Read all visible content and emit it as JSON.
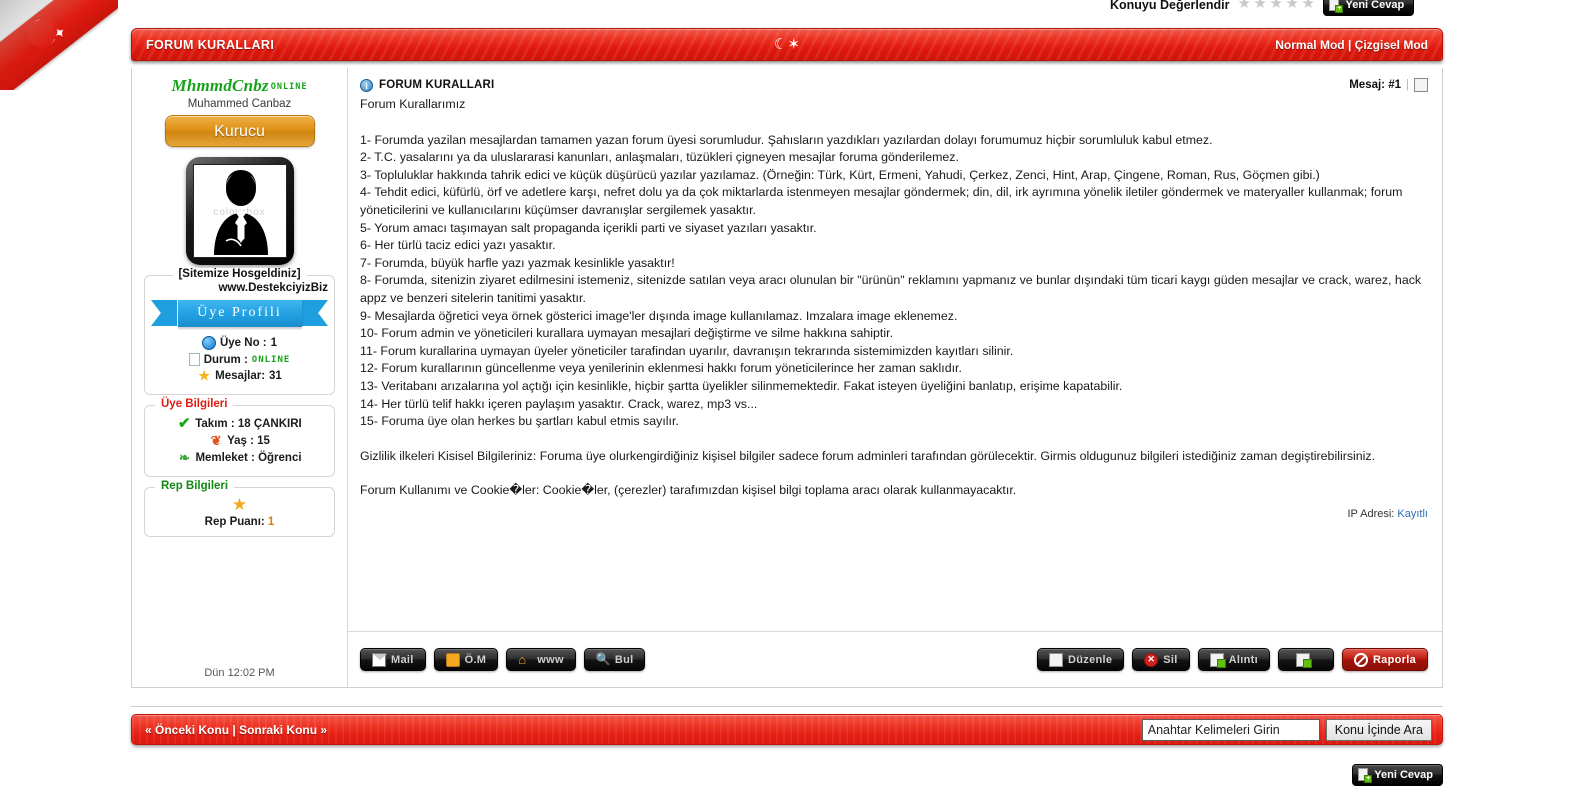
{
  "topbar": {
    "rating_label": "Konuyu Değerlendir",
    "stars": 5,
    "new_reply_label": "Yeni Cevap"
  },
  "titlebar": {
    "title": "FORUM KURALLARI",
    "center_icon": "turkish-crescent-star",
    "mode_normal": "Normal Mod",
    "mode_separator": "|",
    "mode_linear": "Çizgisel Mod"
  },
  "sidebar": {
    "username": "MhmmdCnbz",
    "online_tag": "ONLINE",
    "realname": "Muhammed Canbaz",
    "rank": "Kurucu",
    "avatar_watermark": "colourbox",
    "welcome_legend": "[Sitemize Hosgeldiniz]",
    "site_url": "www.DestekciyizBiz",
    "ribbon_label": "Üye Profili",
    "stats": [
      {
        "icon": "globe-icon",
        "label": "Üye No :",
        "value": "1",
        "value_style": "plain"
      },
      {
        "icon": "doc-icon",
        "label": "Durum :",
        "value": "ONLINE",
        "value_style": "green"
      },
      {
        "icon": "star-icon",
        "label": "Mesajlar:",
        "value": "31",
        "value_style": "plain"
      }
    ],
    "member_info_legend": "Üye Bilgileri",
    "member_info": [
      {
        "icon": "check-icon",
        "text": "Takım : 18 ÇANKIRI"
      },
      {
        "icon": "tree-icon",
        "text": "Yaş : 15"
      },
      {
        "icon": "leaf-icon",
        "text": "Memleket : Öğrenci"
      }
    ],
    "rep_legend": "Rep Bilgileri",
    "rep_label": "Rep Puanı:",
    "rep_value": "1",
    "posted_time": "Dün 12:02 PM"
  },
  "post": {
    "icon": "info-icon",
    "title": "FORUM KURALLARI",
    "message_no_label": "Mesaj: #1",
    "separator": "|",
    "lead": "Forum Kurallarımız",
    "rules": [
      "1- Forumda yazilan mesajlardan tamamen yazan forum üyesi sorumludur. Şahısların yazdıkları yazılardan dolayı forumumuz hiçbir sorumluluk kabul etmez.",
      "2- T.C. yasalarını ya da uluslararasi kanunları, anlaşmaları, tüzükleri çigneyen mesajlar foruma gönderilemez.",
      "3- Topluluklar hakkında tahrik edici ve küçük düşürücü yazılar yazılamaz. (Örneğin: Türk, Kürt, Ermeni, Yahudi, Çerkez, Zenci, Hint, Arap, Çingene, Roman, Rus, Göçmen gibi.)",
      "4- Tehdit edici, küfürlü, örf ve adetlere karşı, nefret dolu ya da çok miktarlarda istenmeyen mesajlar göndermek; din, dil, irk ayrımına yönelik iletiler göndermek ve materyaller kullanmak; forum yöneticilerini ve kullanıcılarını küçümser davranışlar sergilemek yasaktır.",
      "5- Yorum amacı taşımayan salt propaganda içerikli parti ve siyaset yazıları yasaktır.",
      "6- Her türlü taciz edici yazı yasaktır.",
      "7- Forumda, büyük harfle yazı yazmak kesinlikle yasaktır!",
      "8- Forumda, sitenizin ziyaret edilmesini istemeniz, sitenizde satılan veya aracı olunulan bir \"ürünün\" reklamını yapmanız ve bunlar dışındaki tüm ticari kaygı güden mesajlar ve crack, warez, hack appz ve benzeri sitelerin tanitimi yasaktır.",
      "9- Mesajlarda öğretici veya örnek gösterici image'ler dışında image kullanılamaz. Imzalara image eklenemez.",
      "10- Forum admin ve yöneticileri kurallara uymayan mesajlari değiştirme ve silme hakkına sahiptir.",
      "11- Forum kurallarina uymayan üyeler yöneticiler tarafindan uyarılır, davranışın tekrarında sistemimizden kayıtları silinir.",
      "12- Forum kurallarının güncellenme veya yenilerinin eklenmesi hakkı forum yöneticilerince her zaman saklıdır.",
      "13- Veritabanı arızalarına yol açtığı için kesinlikle, hiçbir şartta üyelikler silinmemektedir. Fakat isteyen üyeliğini banlatıp, erişime kapatabilir.",
      "14- Her türlü telif hakkı içeren paylaşım yasaktır. Crack, warez, mp3 vs...",
      "15- Foruma üye olan herkes bu şartları kabul etmis sayılır."
    ],
    "privacy_paragraph": "Gizlilik ilkeleri Kisisel Bilgileriniz: Foruma üye olurkengirdiğiniz kişisel bilgiler sadece forum adminleri tarafından görülecektir. Girmis oldugunuz bilgileri istediğiniz zaman degiştirebilirsiniz.",
    "cookie_paragraph": "Forum Kullanımı ve Cookie�ler: Cookie�ler, (çerezler) tarafımızdan kişisel bilgi toplama aracı olarak kullanmayacaktır.",
    "ip_label": "IP Adresi:",
    "ip_value": "Kayıtlı"
  },
  "postbuttons": {
    "left": [
      {
        "icon": "envelope-icon",
        "label": "Mail"
      },
      {
        "icon": "pm-icon",
        "label": "Ö.M"
      },
      {
        "icon": "home-icon",
        "label": "www"
      },
      {
        "icon": "magnifier-icon",
        "label": "Bul"
      }
    ],
    "right": [
      {
        "icon": "edit-icon",
        "label": "Düzenle",
        "style": "dark"
      },
      {
        "icon": "delete-icon",
        "label": "Sil",
        "style": "dark"
      },
      {
        "icon": "quote-icon",
        "label": "Alıntı",
        "style": "dark"
      },
      {
        "icon": "multiquote-icon",
        "label": "",
        "style": "dark"
      },
      {
        "icon": "report-icon",
        "label": "Raporla",
        "style": "red"
      }
    ]
  },
  "bottomnav": {
    "prev_topic": "« Önceki Konu",
    "separator": "|",
    "next_topic": "Sonraki Konu »",
    "search_value": "Anahtar Kelimeleri Girin",
    "search_placeholder": "Anahtar Kelimeleri Girin",
    "search_button": "Konu İçinde Ara"
  },
  "footer": {
    "new_reply_label": "Yeni Cevap"
  },
  "colors": {
    "accent_red": "#e41e12",
    "green": "#16a31a",
    "orange": "#e07b00",
    "blue": "#1f9fe0"
  }
}
